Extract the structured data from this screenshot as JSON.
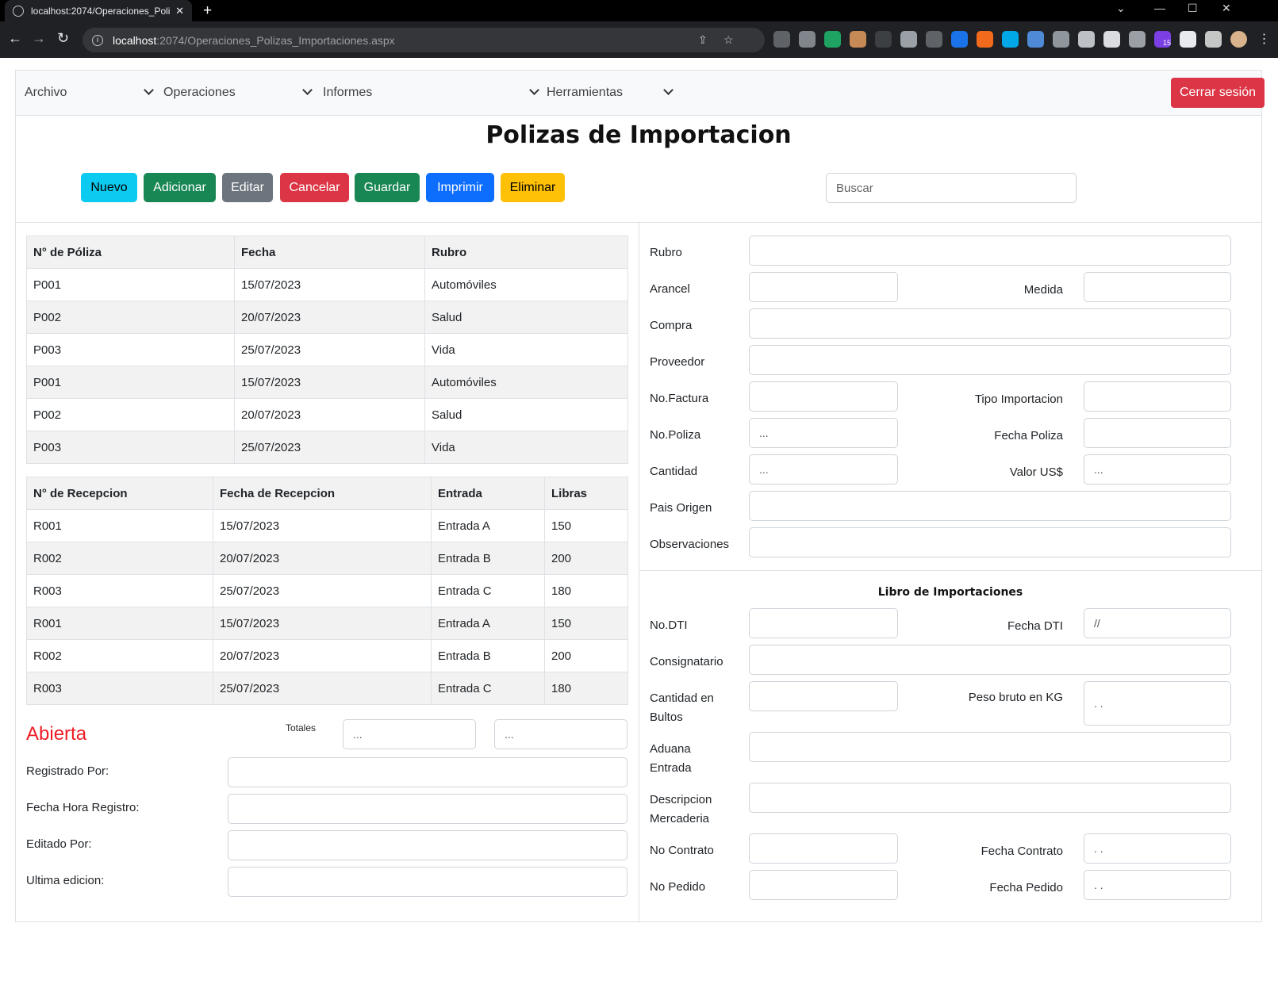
{
  "browser": {
    "tab_title": "localhost:2074/Operaciones_Poli:",
    "url_host": "localhost",
    "url_path": ":2074/Operaciones_Polizas_Importaciones.aspx",
    "extension_badge": "15"
  },
  "nav": {
    "menu": [
      "Archivo",
      "Operaciones",
      "Informes",
      "Herramientas"
    ],
    "logout": "Cerrar sesión"
  },
  "page": {
    "title": "Polizas de Importacion",
    "search_placeholder": "Buscar"
  },
  "toolbar": {
    "nuevo": "Nuevo",
    "adicionar": "Adicionar",
    "editar": "Editar",
    "cancelar": "Cancelar",
    "guardar": "Guardar",
    "imprimir": "Imprimir",
    "eliminar": "Eliminar"
  },
  "polizas": {
    "headers": [
      "N° de Póliza",
      "Fecha",
      "Rubro"
    ],
    "rows": [
      [
        "P001",
        "15/07/2023",
        "Automóviles"
      ],
      [
        "P002",
        "20/07/2023",
        "Salud"
      ],
      [
        "P003",
        "25/07/2023",
        "Vida"
      ],
      [
        "P001",
        "15/07/2023",
        "Automóviles"
      ],
      [
        "P002",
        "20/07/2023",
        "Salud"
      ],
      [
        "P003",
        "25/07/2023",
        "Vida"
      ]
    ]
  },
  "recepciones": {
    "headers": [
      "N° de Recepcion",
      "Fecha de Recepcion",
      "Entrada",
      "Libras"
    ],
    "rows": [
      [
        "R001",
        "15/07/2023",
        "Entrada A",
        "150"
      ],
      [
        "R002",
        "20/07/2023",
        "Entrada B",
        "200"
      ],
      [
        "R003",
        "25/07/2023",
        "Entrada C",
        "180"
      ],
      [
        "R001",
        "15/07/2023",
        "Entrada A",
        "150"
      ],
      [
        "R002",
        "20/07/2023",
        "Entrada B",
        "200"
      ],
      [
        "R003",
        "25/07/2023",
        "Entrada C",
        "180"
      ]
    ]
  },
  "totals": {
    "status": "Abierta",
    "label": "Totales",
    "total1": "...",
    "total2": "..."
  },
  "audit": {
    "registrado_por": "Registrado Por:",
    "fecha_hora_registro": "Fecha Hora Registro:",
    "editado_por": "Editado Por:",
    "ultima_edicion": "Ultima edicion:"
  },
  "form": {
    "rubro": "Rubro",
    "arancel": "Arancel",
    "medida": "Medida",
    "compra": "Compra",
    "proveedor": "Proveedor",
    "no_factura": "No.Factura",
    "tipo_importacion": "Tipo Importacion",
    "no_poliza": "No.Poliza",
    "no_poliza_value": "...",
    "fecha_poliza": "Fecha Poliza",
    "cantidad": "Cantidad",
    "cantidad_value": "...",
    "valor_usd": "Valor US$",
    "valor_usd_value": "...",
    "pais_origen": "Pais Origen",
    "observaciones": "Observaciones"
  },
  "libro": {
    "title": "Libro de Importaciones",
    "no_dti": "No.DTI",
    "fecha_dti": "Fecha DTI",
    "fecha_dti_value": "//",
    "consignatario": "Consignatario",
    "cantidad_bultos": "Cantidad en Bultos",
    "peso_bruto": "Peso bruto en KG",
    "peso_bruto_value": ". .",
    "aduana_entrada": "Aduana Entrada",
    "descripcion_mercaderia": "Descripcion Mercaderia",
    "no_contrato": "No Contrato",
    "fecha_contrato": "Fecha Contrato",
    "fecha_contrato_value": ". .",
    "no_pedido": "No Pedido",
    "fecha_pedido": "Fecha Pedido",
    "fecha_pedido_value": ". ."
  },
  "colors": {
    "info": "#0dcaf0",
    "success": "#198754",
    "secondary": "#6c757d",
    "danger": "#dc3545",
    "primary": "#0d6efd",
    "warning": "#ffc107",
    "status_red": "#ee1c25"
  }
}
